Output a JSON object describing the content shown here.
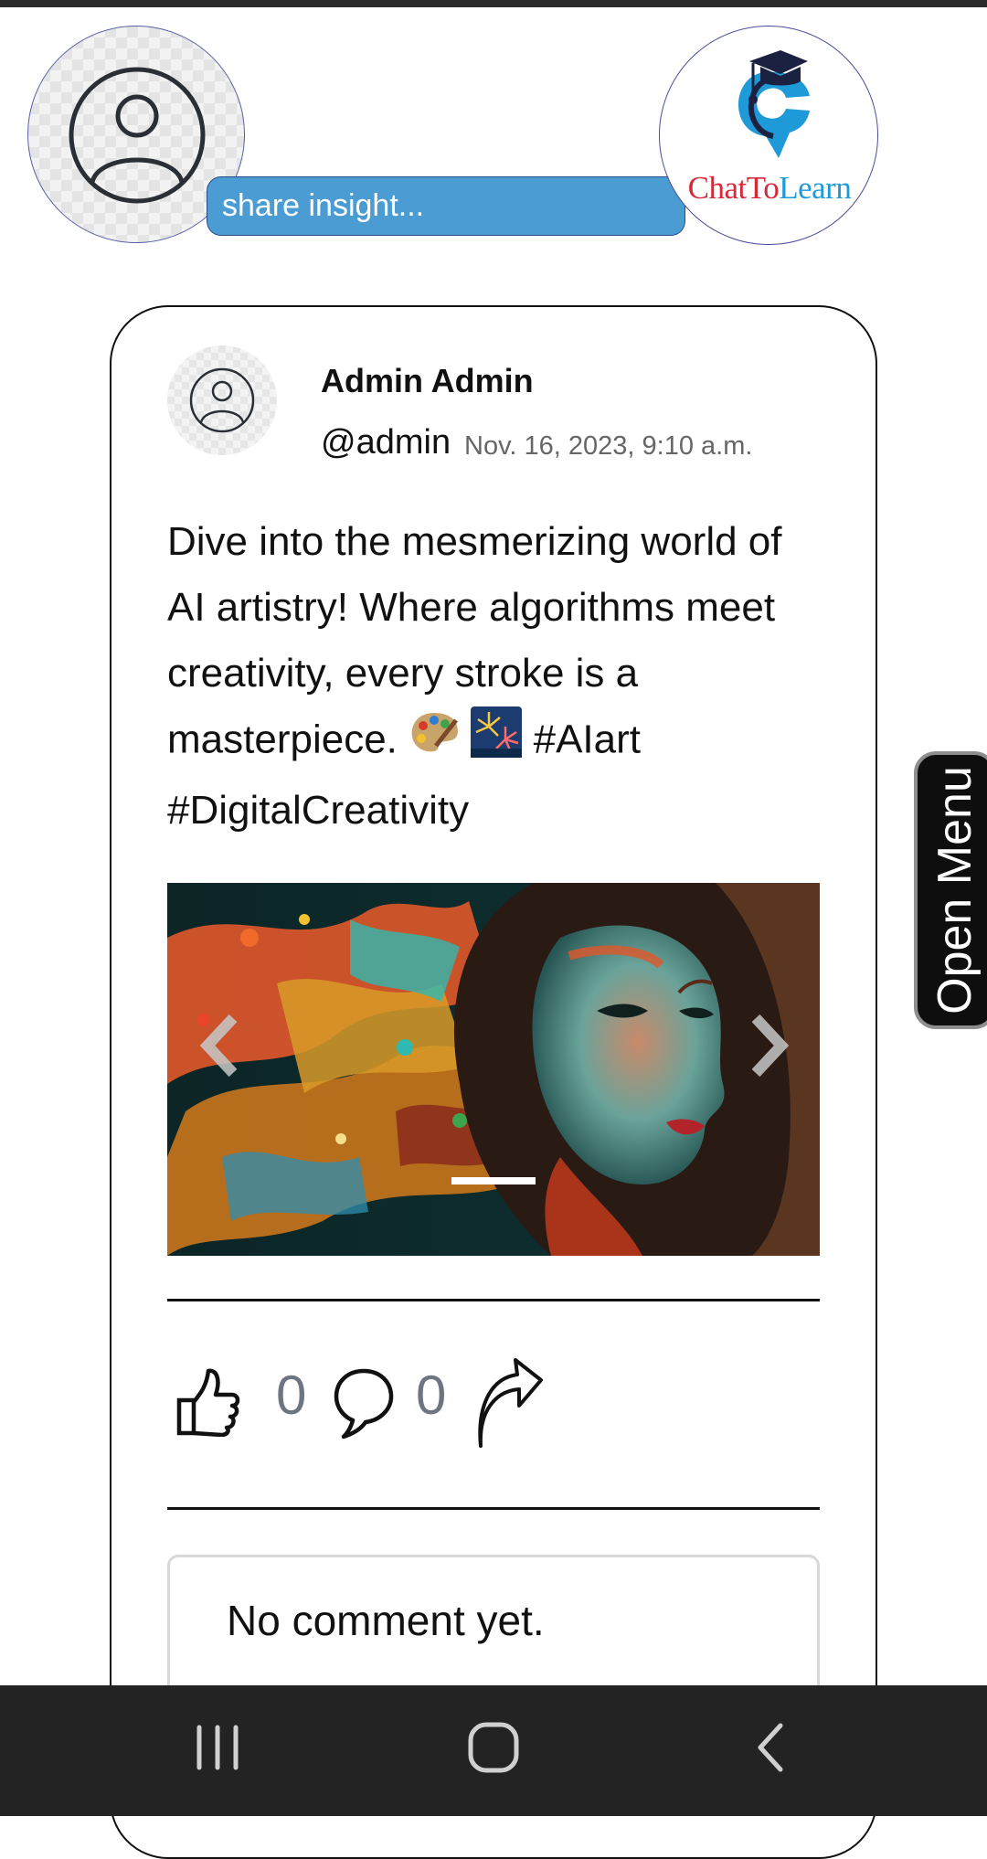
{
  "header": {
    "share_placeholder": "share insight...",
    "logo": {
      "text_part1": "ChatTo",
      "text_part2": "Learn"
    }
  },
  "post": {
    "author_name": "Admin Admin",
    "author_handle": "@admin",
    "timestamp": "Nov. 16, 2023, 9:10 a.m.",
    "text_before": "Dive into the mesmerizing world of AI artistry! Where algorithms meet creativity, every stroke is a masterpiece.",
    "text_after": "#AIart #DigitalCreativity",
    "emojis": [
      "artist-palette",
      "fireworks"
    ],
    "likes": "0",
    "comments": "0",
    "comment_placeholder": "No comment yet."
  },
  "side_menu": {
    "label": "Open Menu"
  },
  "nav_bar": {
    "buttons": [
      "recent-apps",
      "home",
      "back"
    ]
  },
  "colors": {
    "share_bg": "#4b9cd3",
    "logo_red": "#d42a3a",
    "logo_blue": "#1f9ad8",
    "count_gray": "#6d7680",
    "nav_bar_bg": "#232323"
  }
}
